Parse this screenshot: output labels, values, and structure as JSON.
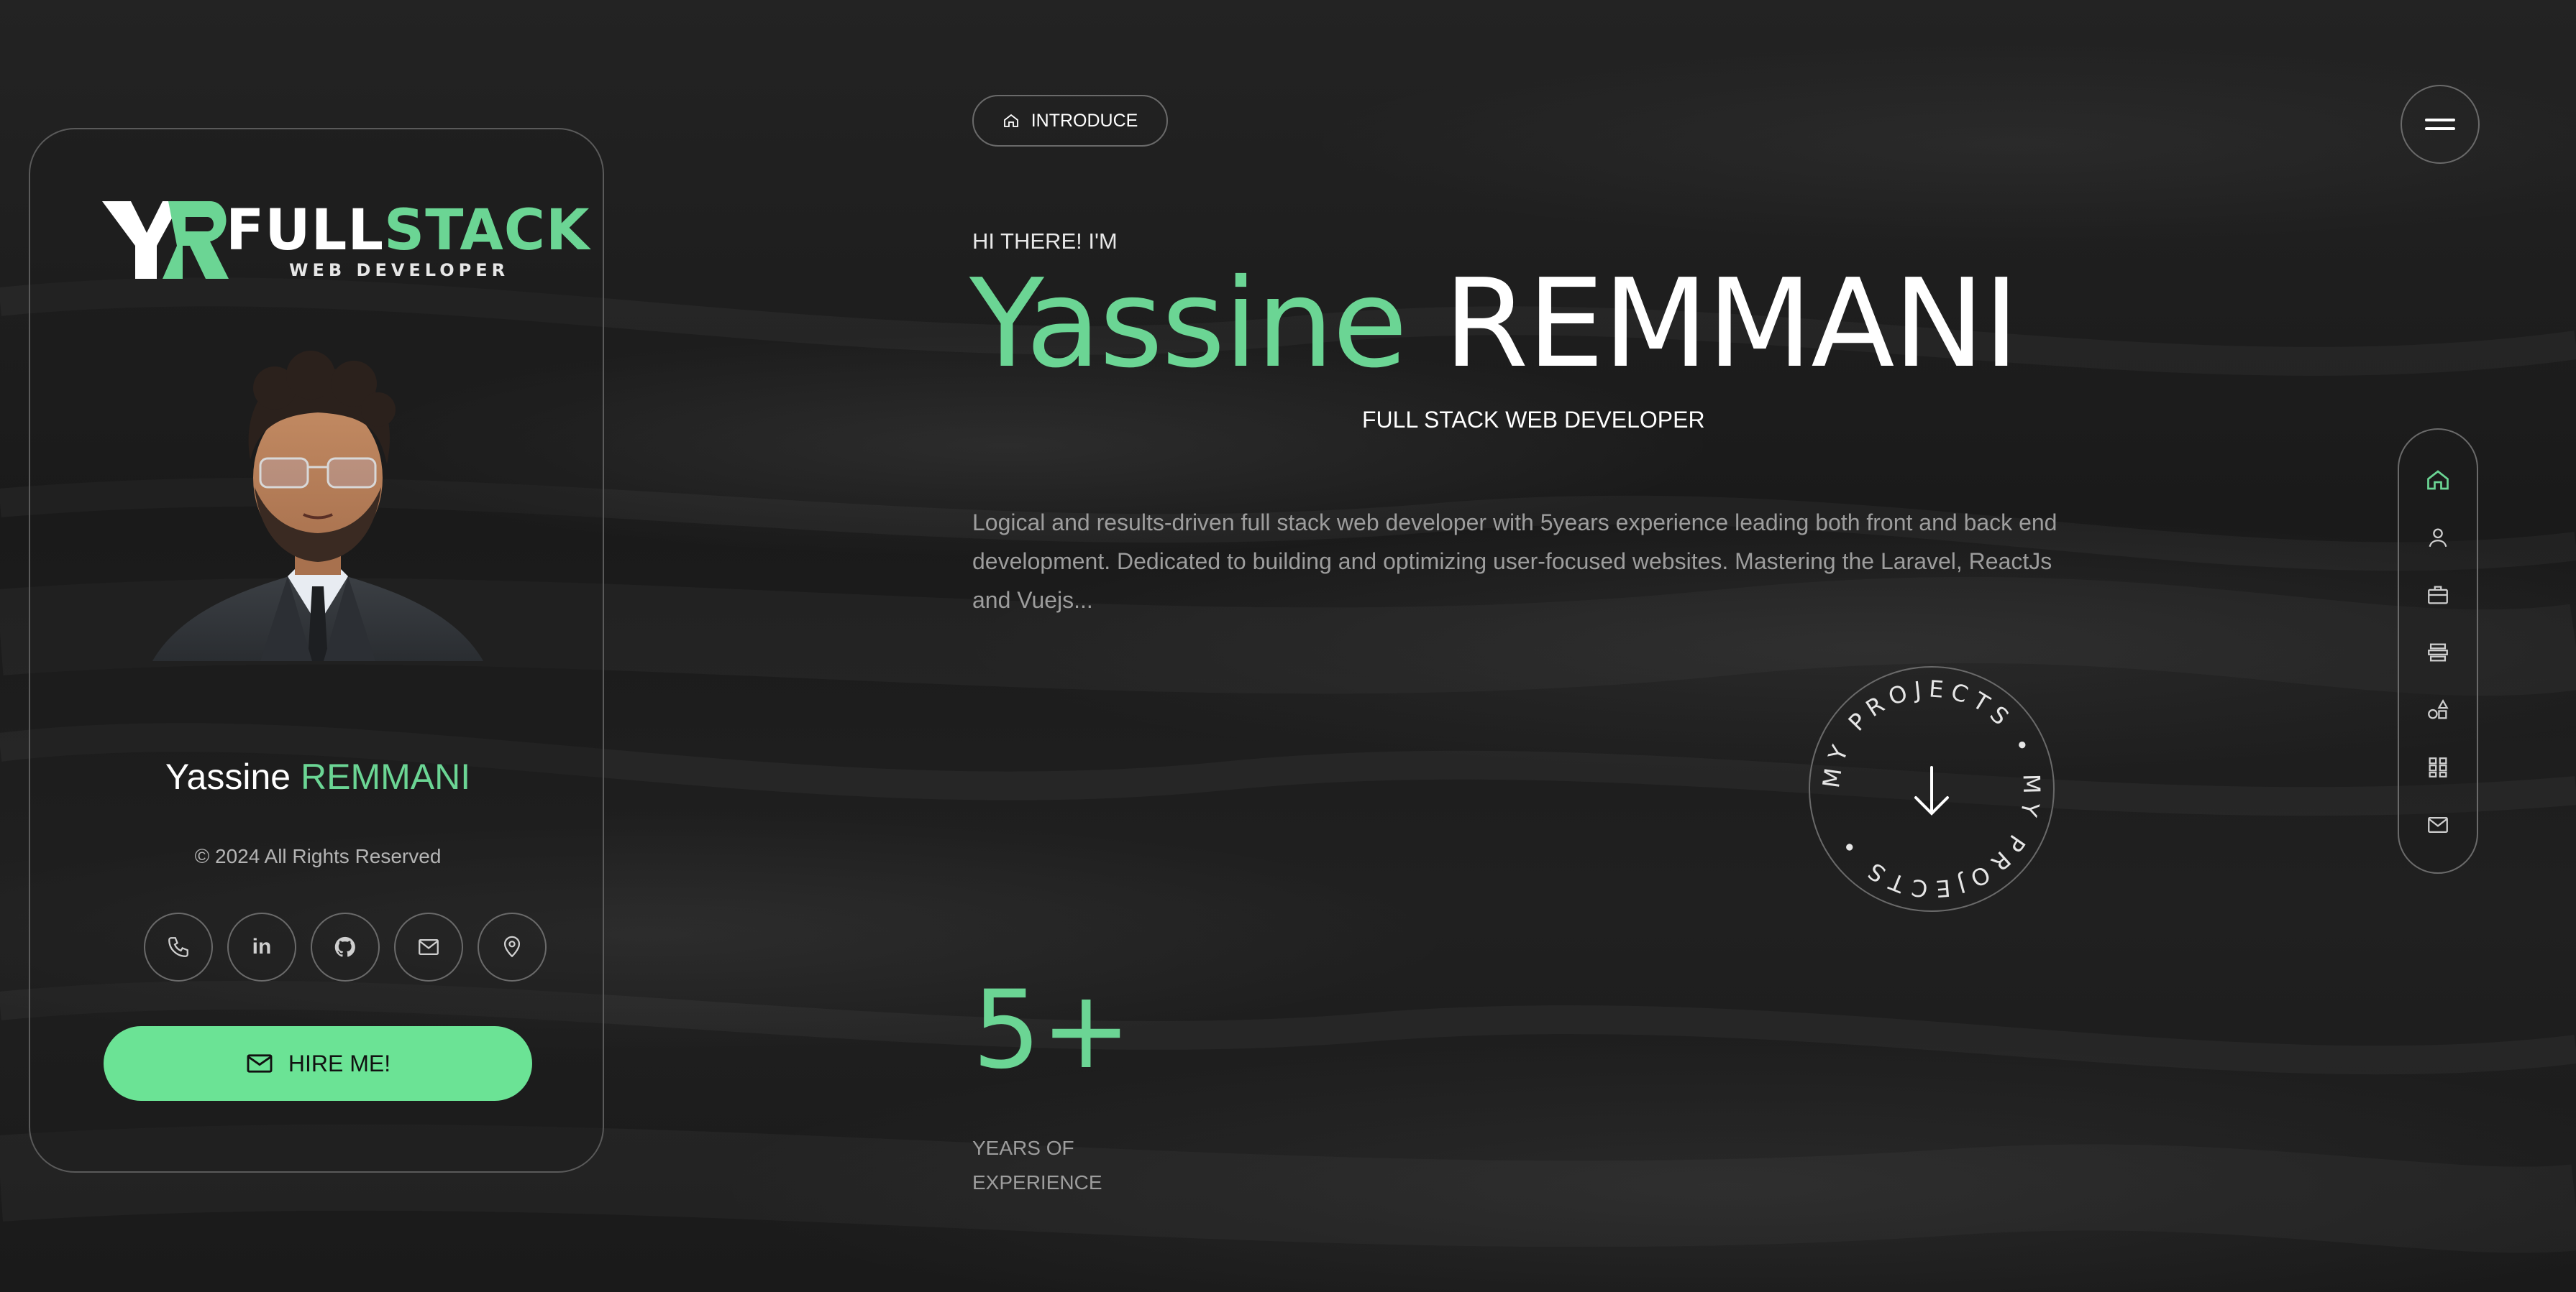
{
  "colors": {
    "accent": "#6bd594",
    "button": "#6be395",
    "border": "#6a6a6a",
    "muted_text": "#9d9d9d"
  },
  "card": {
    "logo": {
      "mark_text": "YR",
      "title_white": "FULL",
      "title_green": "STACK",
      "subtitle": "WEB DEVELOPER"
    },
    "name_first": "Yassine",
    "name_last": "REMMANI",
    "copyright": "© 2024 All Rights Reserved",
    "socials": [
      {
        "icon": "phone-icon"
      },
      {
        "icon": "linkedin-icon",
        "text": "in"
      },
      {
        "icon": "github-icon"
      },
      {
        "icon": "mail-icon"
      },
      {
        "icon": "location-pin-icon"
      }
    ],
    "hire_label": "HIRE ME!"
  },
  "main": {
    "section_pill": "INTRODUCE",
    "greeting": "HI THERE! I'M",
    "name_first": "Yassine",
    "name_last": "REMMANI",
    "role": "FULL STACK WEB DEVELOPER",
    "bio": "Logical and results-driven full stack web developer with 5years experience leading both front and back end development. Dedicated to building and optimizing user-focused websites. Mastering the Laravel, ReactJs and Vuejs...",
    "projects_circle_text": "MY PROJECTS • MY PROJECTS •",
    "stat_value": "5+",
    "stat_label_1": "YEARS OF",
    "stat_label_2": "EXPERIENCE"
  },
  "side_nav": [
    {
      "icon": "home-icon",
      "active": true
    },
    {
      "icon": "user-icon",
      "active": false
    },
    {
      "icon": "briefcase-icon",
      "active": false
    },
    {
      "icon": "resume-icon",
      "active": false
    },
    {
      "icon": "services-icon",
      "active": false
    },
    {
      "icon": "portfolio-grid-icon",
      "active": false
    },
    {
      "icon": "contact-mail-icon",
      "active": false
    }
  ]
}
